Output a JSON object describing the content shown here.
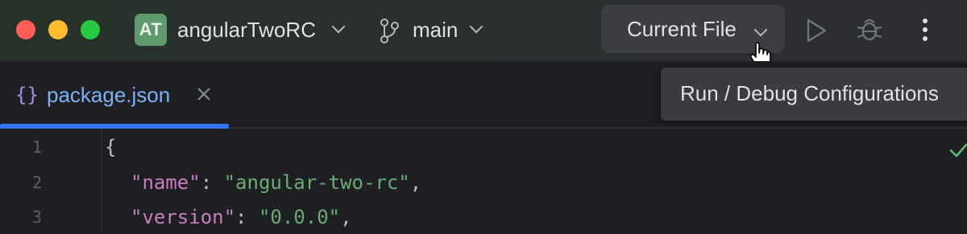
{
  "titlebar": {
    "project_initials": "AT",
    "project_name": "angularTwoRC",
    "branch_name": "main",
    "run_config_label": "Current File",
    "colors": {
      "badge": "#5f9b6d",
      "close": "#ff5f57",
      "minimize": "#febc2e",
      "maximize": "#28c840"
    },
    "icons": [
      "branch-icon",
      "chevron-down-icon",
      "run-icon",
      "debug-icon",
      "more-vertical-icon"
    ]
  },
  "tooltip": {
    "text": "Run / Debug Configurations"
  },
  "tabs": [
    {
      "icon": "{}",
      "label": "package.json",
      "active": true
    }
  ],
  "editor": {
    "lines": [
      {
        "number": "1",
        "open": "{"
      },
      {
        "number": "2",
        "key": "\"name\"",
        "sep": ": ",
        "value": "\"angular-two-rc\"",
        "end": ","
      },
      {
        "number": "3",
        "key": "\"version\"",
        "sep": ": ",
        "value": "\"0.0.0\"",
        "end": ","
      }
    ],
    "status_icon": "check-icon"
  }
}
